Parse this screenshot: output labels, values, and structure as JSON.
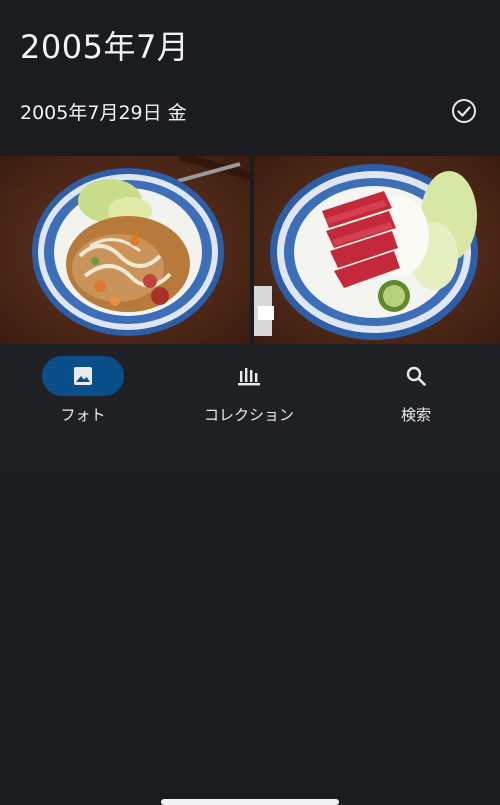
{
  "header": {
    "month_title": "2005年7月"
  },
  "day_group": {
    "date_label": "2005年7月29日 金"
  },
  "photos": [
    {
      "icon": "food-photo-stirfry"
    },
    {
      "icon": "food-photo-sashimi"
    }
  ],
  "bottom_nav": {
    "items": [
      {
        "label": "フォト",
        "icon": "photo-icon",
        "active": true
      },
      {
        "label": "コレクション",
        "icon": "collections-icon",
        "active": false
      },
      {
        "label": "検索",
        "icon": "search-icon",
        "active": false
      }
    ]
  },
  "colors": {
    "background": "#1b1c1f",
    "nav_background": "#1f2024",
    "active_pill": "#0b4f8a"
  }
}
